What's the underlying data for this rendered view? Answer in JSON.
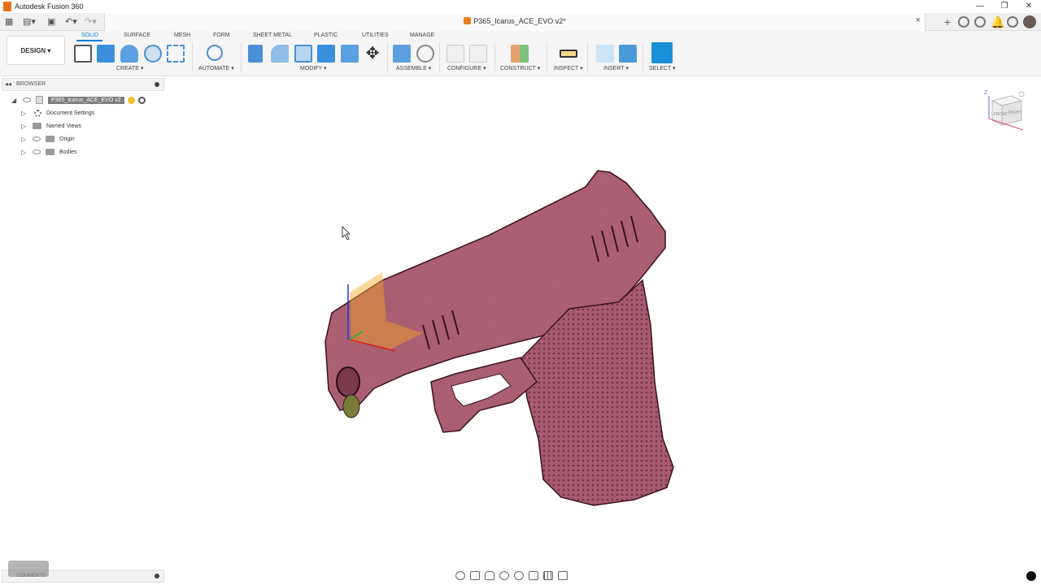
{
  "app": {
    "window_title": "Autodesk Fusion 360",
    "document_title": "P365_Icarus_ACE_EVO v2*",
    "window_controls": [
      "—",
      "❐",
      "✕"
    ],
    "tab_close": "×"
  },
  "ribbon": {
    "workspace": "DESIGN ▾",
    "tabs": [
      "SOLID",
      "SURFACE",
      "MESH",
      "FORM",
      "SHEET METAL",
      "PLASTIC",
      "UTILITIES",
      "MANAGE"
    ],
    "active_tab": "SOLID",
    "groups": [
      "CREATE ▾",
      "AUTOMATE ▾",
      "MODIFY ▾",
      "ASSEMBLE ▾",
      "CONFIGURE ▾",
      "CONSTRUCT ▾",
      "INSPECT ▾",
      "INSERT ▾",
      "SELECT ▾"
    ]
  },
  "browser": {
    "title": "BROWSER",
    "root": "P365_Icarus_ACE_EVO v2",
    "items": [
      "Document Settings",
      "Named Views",
      "Origin",
      "Bodies"
    ]
  },
  "comments": {
    "title": "COMMENTS"
  },
  "viewcube": {
    "faces": [
      "FRONT",
      "RIGHT"
    ],
    "axis": "Z"
  },
  "colors": {
    "accent": "#0a7fd6",
    "model": "#b8697d",
    "model_dark": "#5a2634",
    "plane": "#f5a623"
  }
}
